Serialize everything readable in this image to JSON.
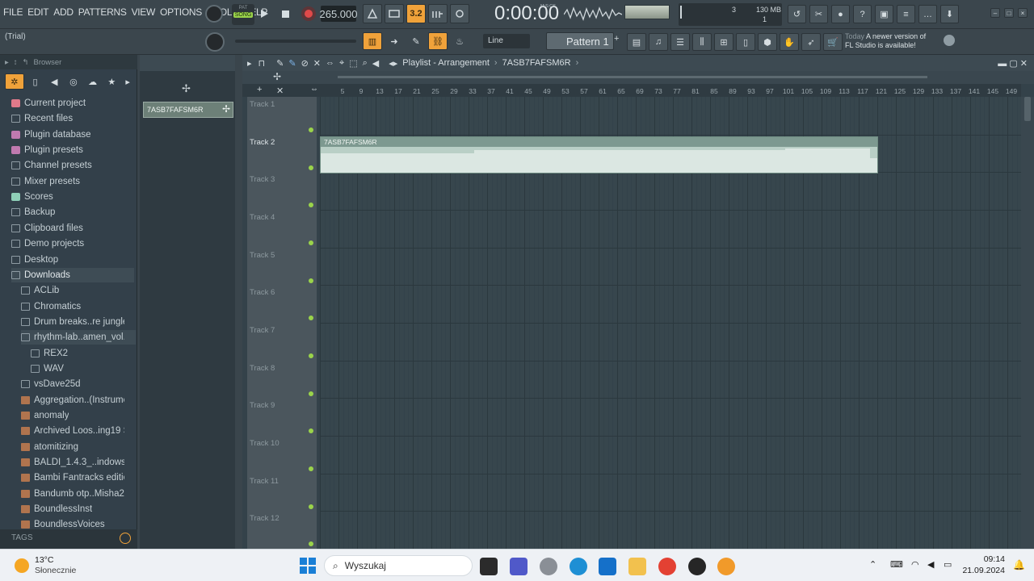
{
  "menu": [
    "FILE",
    "EDIT",
    "ADD",
    "PATTERNS",
    "VIEW",
    "OPTIONS",
    "TOOLS",
    "HELP"
  ],
  "transport": {
    "pat_label": "PAT",
    "song_label": "SONG",
    "tempo": "265.000",
    "time": "0:00:00",
    "time_unit": "M:S:CS",
    "cpu_count": "3",
    "mem": "130 MB",
    "poly": "1",
    "snap_label": "3.2"
  },
  "hint": "(Trial)",
  "snap_mode": "Line",
  "pattern": "Pattern 1",
  "notice": {
    "day": "Today",
    "text_line1": "A newer version of",
    "text_line2": "FL Studio is available!"
  },
  "browser": {
    "title": "Browser",
    "items": [
      {
        "label": "Current project",
        "type": "project",
        "indent": 0
      },
      {
        "label": "Recent files",
        "type": "folder",
        "indent": 0
      },
      {
        "label": "Plugin database",
        "type": "plugin",
        "indent": 0
      },
      {
        "label": "Plugin presets",
        "type": "plugin",
        "indent": 0
      },
      {
        "label": "Channel presets",
        "type": "folder",
        "indent": 0
      },
      {
        "label": "Mixer presets",
        "type": "folder",
        "indent": 0
      },
      {
        "label": "Scores",
        "type": "note",
        "indent": 0
      },
      {
        "label": "Backup",
        "type": "folder",
        "indent": 0
      },
      {
        "label": "Clipboard files",
        "type": "folder",
        "indent": 0
      },
      {
        "label": "Demo projects",
        "type": "folder",
        "indent": 0
      },
      {
        "label": "Desktop",
        "type": "folder",
        "indent": 0
      },
      {
        "label": "Downloads",
        "type": "folder",
        "indent": 0
      },
      {
        "label": "ACLib",
        "type": "folder",
        "indent": 1
      },
      {
        "label": "Chromatics",
        "type": "folder",
        "indent": 1
      },
      {
        "label": "Drum breaks..re jungle dnb",
        "type": "folder",
        "indent": 1
      },
      {
        "label": "rhythm-lab..amen_vol.1",
        "type": "folder",
        "indent": 1
      },
      {
        "label": "REX2",
        "type": "folder",
        "indent": 2
      },
      {
        "label": "WAV",
        "type": "folder",
        "indent": 2
      },
      {
        "label": "vsDave25d",
        "type": "folder",
        "indent": 1
      },
      {
        "label": "Aggregation..(Instrumental)",
        "type": "file",
        "indent": 1
      },
      {
        "label": "anomaly",
        "type": "file",
        "indent": 1
      },
      {
        "label": "Archived Loos..ing19 Sprites",
        "type": "file",
        "indent": 1
      },
      {
        "label": "atomitizing",
        "type": "file",
        "indent": 1
      },
      {
        "label": "BALDI_1.4.3_..indows_64Bit",
        "type": "file",
        "indent": 1
      },
      {
        "label": "Bambi Fantracks edition V6",
        "type": "file",
        "indent": 1
      },
      {
        "label": "Bandumb otp..Misha21220)",
        "type": "file",
        "indent": 1
      },
      {
        "label": "BoundlessInst",
        "type": "file",
        "indent": 1
      },
      {
        "label": "BoundlessVoices",
        "type": "file",
        "indent": 1
      }
    ],
    "tags_label": "TAGS"
  },
  "pattern_list": {
    "selected": "7ASB7FAFSM6R"
  },
  "playlist": {
    "title": "Playlist - Arrangement",
    "arrangement": "7ASB7FAFSM6R",
    "tracks": [
      "Track 1",
      "Track 2",
      "Track 3",
      "Track 4",
      "Track 5",
      "Track 6",
      "Track 7",
      "Track 8",
      "Track 9",
      "Track 10",
      "Track 11",
      "Track 12"
    ],
    "ruler": [
      "5",
      "9",
      "13",
      "17",
      "21",
      "25",
      "29",
      "33",
      "37",
      "41",
      "45",
      "49",
      "53",
      "57",
      "61",
      "65",
      "69",
      "73",
      "77",
      "81",
      "85",
      "89",
      "93",
      "97",
      "101",
      "105",
      "109",
      "113",
      "117",
      "121",
      "125",
      "129",
      "133",
      "137",
      "141",
      "145",
      "149"
    ],
    "clip": {
      "label": "7ASB7FAFSM6R",
      "track": "Track 2"
    }
  },
  "taskbar": {
    "weather_temp": "13°C",
    "weather_desc": "Słonecznie",
    "search_placeholder": "Wyszukaj",
    "time": "09:14",
    "date": "21.09.2024"
  },
  "colors": {
    "accent": "#f0a23a",
    "clip": "#b9cfc6",
    "led": "#9ad34a"
  }
}
